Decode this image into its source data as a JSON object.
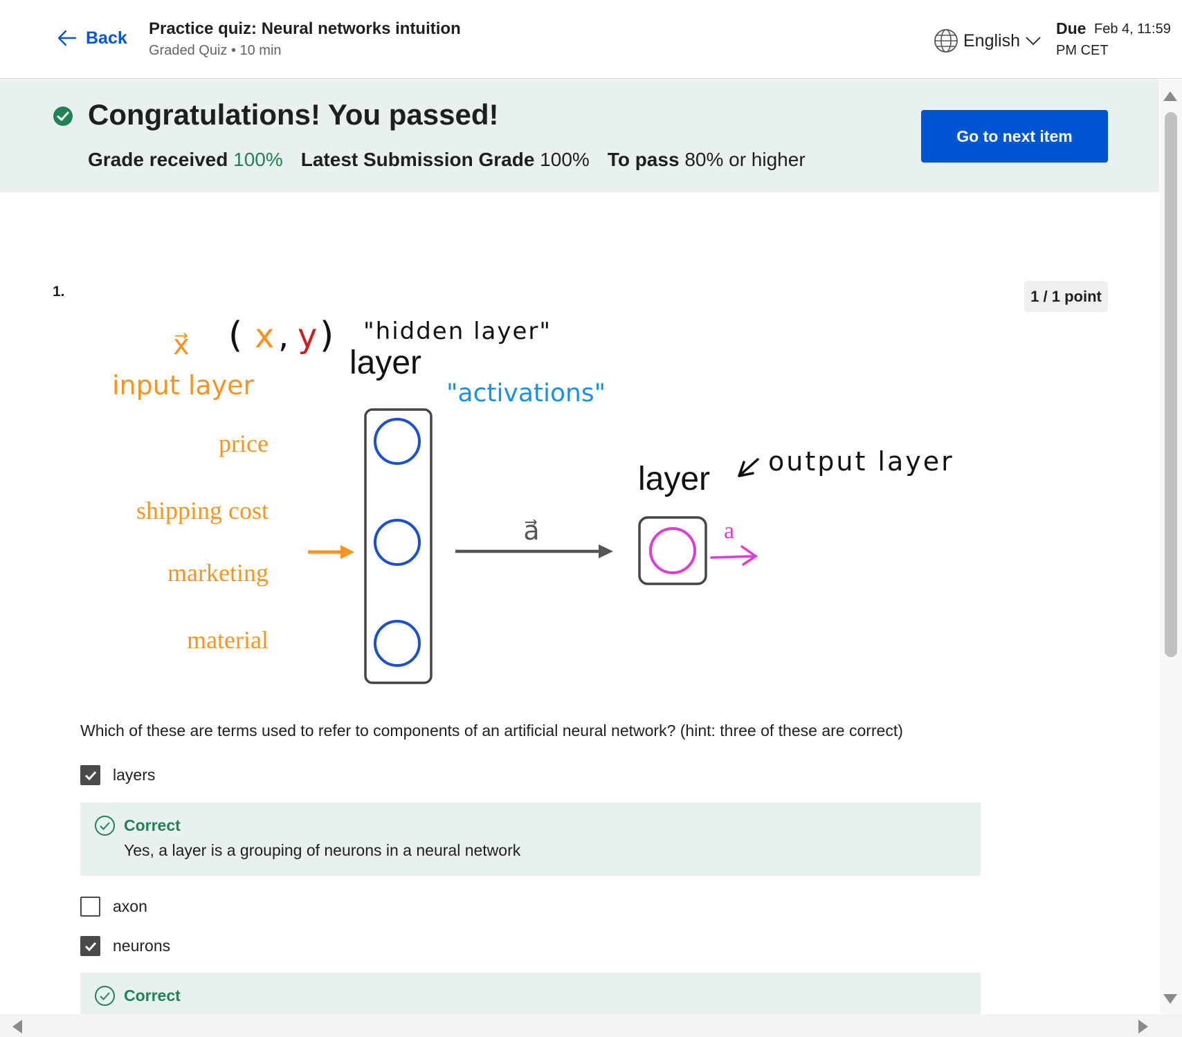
{
  "header": {
    "back_label": "Back",
    "title": "Practice quiz: Neural networks intuition",
    "subtitle": "Graded Quiz • 10 min",
    "language": "English",
    "due_label": "Due",
    "due_date": "Feb 4, 11:59",
    "due_tz": "PM CET"
  },
  "banner": {
    "title": "Congratulations! You passed!",
    "grade_received_label": "Grade received",
    "grade_received_value": "100%",
    "latest_label": "Latest Submission Grade",
    "latest_value": "100%",
    "to_pass_label": "To pass",
    "to_pass_value": "80% or higher",
    "next_button": "Go to next item",
    "accent_color": "#1f8354",
    "button_color": "#0056d2"
  },
  "question": {
    "number": "1.",
    "points": "1 / 1 point",
    "text": "Which of these are terms used to refer to components of an artificial neural network? (hint: three of these are correct)",
    "diagram": {
      "x_vec": "x⃗",
      "xy": [
        "(",
        "x",
        ",",
        "y",
        ")"
      ],
      "hidden_layer": "\"hidden layer\"",
      "layer_top": "layer",
      "input_layer": "input layer",
      "activations": "\"activations\"",
      "inputs": [
        "price",
        "shipping cost",
        "marketing",
        "material"
      ],
      "a_vec": "a⃗",
      "layer_output": "layer",
      "output_layer": "output layer",
      "a_out": "a"
    },
    "options": [
      {
        "label": "layers",
        "checked": true,
        "feedback_title": "Correct",
        "feedback_text": "Yes, a layer is a grouping of neurons in a neural network"
      },
      {
        "label": "axon",
        "checked": false
      },
      {
        "label": "neurons",
        "checked": true,
        "feedback_title": "Correct"
      }
    ]
  }
}
